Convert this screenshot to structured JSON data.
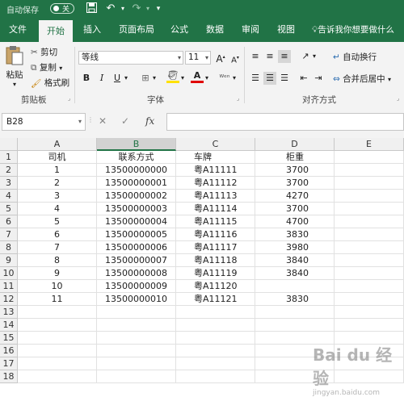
{
  "titlebar": {
    "autosave_label": "自动保存",
    "autosave_state": "关",
    "icons": [
      "save-icon",
      "undo-icon",
      "redo-icon",
      "customize-icon"
    ]
  },
  "tabs": [
    {
      "label": "文件",
      "active": false
    },
    {
      "label": "开始",
      "active": true
    },
    {
      "label": "插入",
      "active": false
    },
    {
      "label": "页面布局",
      "active": false
    },
    {
      "label": "公式",
      "active": false
    },
    {
      "label": "数据",
      "active": false
    },
    {
      "label": "审阅",
      "active": false
    },
    {
      "label": "视图",
      "active": false
    }
  ],
  "tell_me": "告诉我你想要做什么",
  "ribbon": {
    "clipboard": {
      "paste": "粘贴",
      "cut": "剪切",
      "copy": "复制",
      "format_painter": "格式刷",
      "group": "剪贴板"
    },
    "font": {
      "font_name": "等线",
      "font_size": "11",
      "bold": "B",
      "italic": "I",
      "underline": "U",
      "group": "字体"
    },
    "alignment": {
      "wrap_text": "自动换行",
      "merge_center": "合并后居中",
      "group": "对齐方式"
    }
  },
  "formula_bar": {
    "name_box": "B28",
    "fx": "fx",
    "value": ""
  },
  "sheet": {
    "columns": [
      "A",
      "B",
      "C",
      "D",
      "E"
    ],
    "selected_column": "B",
    "rows": [
      [
        "司机",
        "联系方式",
        "车牌",
        "柜重",
        ""
      ],
      [
        "1",
        "13500000000",
        "粤A11111",
        "3700",
        ""
      ],
      [
        "2",
        "13500000001",
        "粤A11112",
        "3700",
        ""
      ],
      [
        "3",
        "13500000002",
        "粤A11113",
        "4270",
        ""
      ],
      [
        "4",
        "13500000003",
        "粤A11114",
        "3700",
        ""
      ],
      [
        "5",
        "13500000004",
        "粤A11115",
        "4700",
        ""
      ],
      [
        "6",
        "13500000005",
        "粤A11116",
        "3830",
        ""
      ],
      [
        "7",
        "13500000006",
        "粤A11117",
        "3980",
        ""
      ],
      [
        "8",
        "13500000007",
        "粤A11118",
        "3840",
        ""
      ],
      [
        "9",
        "13500000008",
        "粤A11119",
        "3840",
        ""
      ],
      [
        "10",
        "13500000009",
        "粤A11120",
        "",
        ""
      ],
      [
        "11",
        "13500000010",
        "粤A11121",
        "3830",
        ""
      ],
      [
        "",
        "",
        "",
        "",
        ""
      ],
      [
        "",
        "",
        "",
        "",
        ""
      ],
      [
        "",
        "",
        "",
        "",
        ""
      ],
      [
        "",
        "",
        "",
        "",
        ""
      ],
      [
        "",
        "",
        "",
        "",
        ""
      ],
      [
        "",
        "",
        "",
        "",
        ""
      ]
    ]
  },
  "colors": {
    "accent": "#217346",
    "ribbon_bg": "#f3f3f3",
    "header_bg": "#f0f0f0"
  },
  "watermark": {
    "text": "Bai du 经验",
    "sub": "jingyan.baidu.com"
  }
}
